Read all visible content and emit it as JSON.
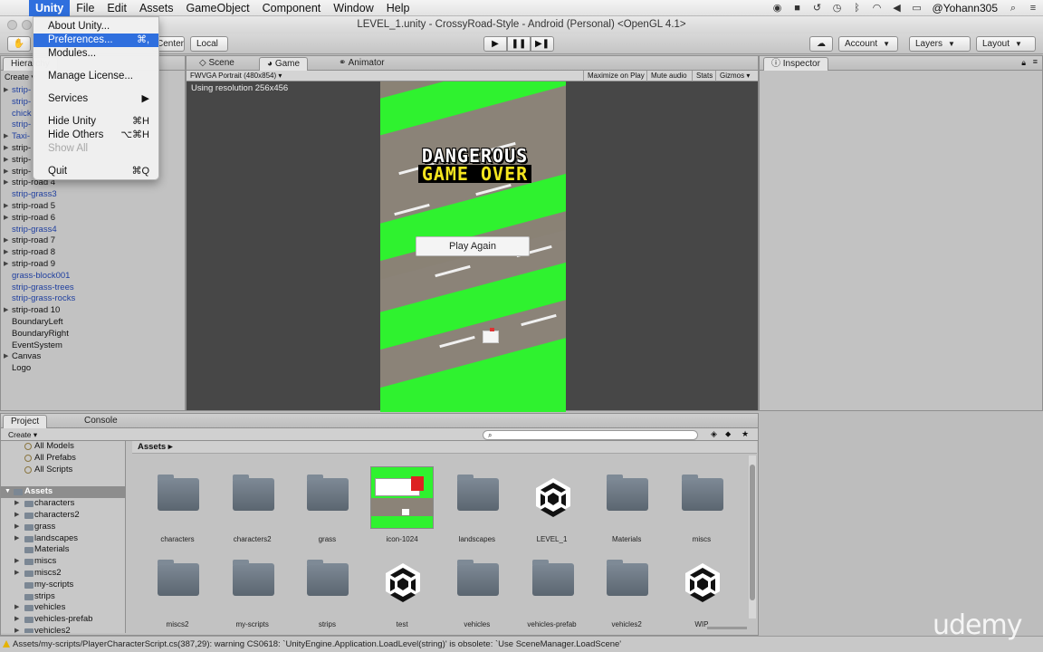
{
  "menubar": {
    "items": [
      "Unity",
      "File",
      "Edit",
      "Assets",
      "GameObject",
      "Component",
      "Window",
      "Help"
    ],
    "active": "Unity",
    "user": "@Yohann305"
  },
  "window_title": "LEVEL_1.unity - CrossyRoad-Style - Android (Personal) <OpenGL 4.1>",
  "toolbar": {
    "pivot_label": "Center",
    "space_label": "Local",
    "account_label": "Account",
    "layers_label": "Layers",
    "layout_label": "Layout"
  },
  "unity_menu": {
    "about": "About Unity...",
    "preferences": "Preferences...",
    "preferences_sc": "⌘,",
    "modules": "Modules...",
    "manage_license": "Manage License...",
    "services": "Services",
    "hide_unity": "Hide Unity",
    "hide_unity_sc": "⌘H",
    "hide_others": "Hide Others",
    "hide_others_sc": "⌥⌘H",
    "show_all": "Show All",
    "quit": "Quit",
    "quit_sc": "⌘Q"
  },
  "hierarchy": {
    "tab": "Hierarchy",
    "create": "Create",
    "partial_rows": [
      "strip-",
      "strip-",
      "chick",
      "strip-",
      "Taxi-",
      "strip-",
      "strip-",
      "strip-"
    ],
    "rows": [
      {
        "label": "strip-road 4",
        "prefab": false,
        "expand": true
      },
      {
        "label": "strip-grass3",
        "prefab": true,
        "expand": false
      },
      {
        "label": "strip-road 5",
        "prefab": false,
        "expand": true
      },
      {
        "label": "strip-road 6",
        "prefab": false,
        "expand": true
      },
      {
        "label": "strip-grass4",
        "prefab": true,
        "expand": false
      },
      {
        "label": "strip-road 7",
        "prefab": false,
        "expand": true
      },
      {
        "label": "strip-road 8",
        "prefab": false,
        "expand": true
      },
      {
        "label": "strip-road 9",
        "prefab": false,
        "expand": true
      },
      {
        "label": "grass-block001",
        "prefab": true,
        "expand": false
      },
      {
        "label": "strip-grass-trees",
        "prefab": true,
        "expand": false
      },
      {
        "label": "strip-grass-rocks",
        "prefab": true,
        "expand": false
      },
      {
        "label": "strip-road 10",
        "prefab": false,
        "expand": true
      },
      {
        "label": "BoundaryLeft",
        "prefab": false,
        "expand": false
      },
      {
        "label": "BoundaryRight",
        "prefab": false,
        "expand": false
      },
      {
        "label": "EventSystem",
        "prefab": false,
        "expand": false
      },
      {
        "label": "Canvas",
        "prefab": false,
        "expand": true
      },
      {
        "label": "Logo",
        "prefab": false,
        "expand": false
      }
    ]
  },
  "game_panel": {
    "tabs": {
      "scene": "Scene",
      "game": "Game",
      "animator": "Animator"
    },
    "aspect": "FWVGA Portrait (480x854)",
    "maximize": "Maximize on Play",
    "mute": "Mute audio",
    "stats": "Stats",
    "gizmos": "Gizmos",
    "resolution_text": "Using resolution 256x456",
    "game_title_line1": "DANGEROUS",
    "game_title_line2": "GAME OVER",
    "play_again": "Play Again"
  },
  "inspector": {
    "tab": "Inspector"
  },
  "project": {
    "tabs": {
      "project": "Project",
      "console": "Console"
    },
    "create": "Create",
    "favorites": [
      "All Models",
      "All Prefabs",
      "All Scripts"
    ],
    "root": "Assets",
    "folders": [
      "characters",
      "characters2",
      "grass",
      "landscapes",
      "Materials",
      "miscs",
      "miscs2",
      "my-scripts",
      "strips",
      "vehicles",
      "vehicles-prefab",
      "vehicles2"
    ],
    "breadcrumb": "Assets",
    "assets": [
      {
        "name": "characters",
        "type": "folder"
      },
      {
        "name": "characters2",
        "type": "folder"
      },
      {
        "name": "grass",
        "type": "folder"
      },
      {
        "name": "icon-1024",
        "type": "image"
      },
      {
        "name": "landscapes",
        "type": "folder"
      },
      {
        "name": "LEVEL_1",
        "type": "scene"
      },
      {
        "name": "Materials",
        "type": "folder"
      },
      {
        "name": "miscs",
        "type": "folder"
      },
      {
        "name": "miscs2",
        "type": "folder"
      },
      {
        "name": "my-scripts",
        "type": "folder"
      },
      {
        "name": "strips",
        "type": "folder"
      },
      {
        "name": "test",
        "type": "scene"
      },
      {
        "name": "vehicles",
        "type": "folder"
      },
      {
        "name": "vehicles-prefab",
        "type": "folder"
      },
      {
        "name": "vehicles2",
        "type": "folder"
      },
      {
        "name": "WIP",
        "type": "scene"
      }
    ]
  },
  "status": "Assets/my-scripts/PlayerCharacterScript.cs(387,29): warning CS0618: `UnityEngine.Application.LoadLevel(string)' is obsolete: `Use SceneManager.LoadScene'",
  "watermark": "udemy",
  "colors": {
    "menu_highlight": "#2f6fde",
    "grass": "#2ff22f",
    "road": "#8b8378",
    "prefab_text": "#1f3f9f"
  }
}
